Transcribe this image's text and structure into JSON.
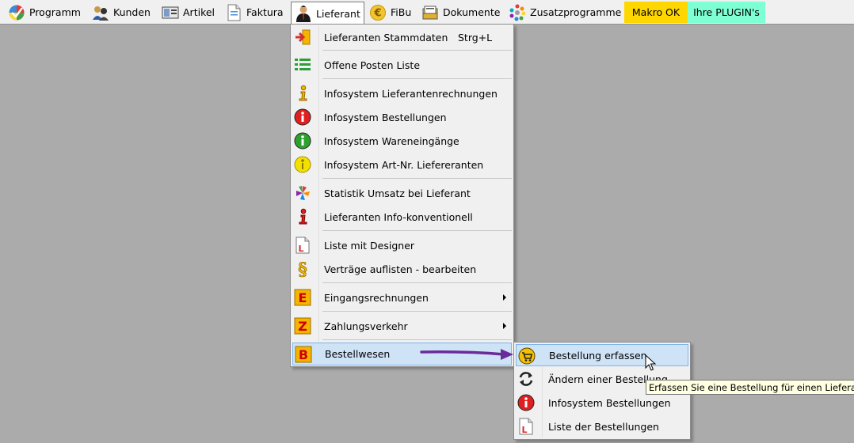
{
  "menubar": {
    "items": [
      {
        "label": "Programm",
        "icon": "programm-icon"
      },
      {
        "label": "Kunden",
        "icon": "kunden-icon"
      },
      {
        "label": "Artikel",
        "icon": "artikel-icon"
      },
      {
        "label": "Faktura",
        "icon": "faktura-icon"
      },
      {
        "label": "Lieferant",
        "icon": "lieferant-icon"
      },
      {
        "label": "FiBu",
        "icon": "fibu-icon"
      },
      {
        "label": "Dokumente",
        "icon": "dokumente-icon"
      },
      {
        "label": "Zusatzprogramme",
        "icon": "zusatzprogramme-icon"
      },
      {
        "label": "Makro OK",
        "color": "#ffd700"
      },
      {
        "label": "Ihre PLUGIN's",
        "color": "#7fffd4"
      }
    ]
  },
  "lieferant_menu": {
    "items": [
      {
        "label": "Lieferanten Stammdaten",
        "shortcut": "Strg+L",
        "icon": "stammdaten-login-icon"
      },
      {
        "label": "Offene Posten Liste",
        "icon": "list-icon"
      },
      {
        "label": "Infosystem Lieferantenrechnungen",
        "icon": "info-yellow-icon"
      },
      {
        "label": "Infosystem Bestellungen",
        "icon": "info-red-circle-icon"
      },
      {
        "label": "Infosystem Wareneingänge",
        "icon": "info-green-circle-icon"
      },
      {
        "label": "Infosystem Art-Nr. Liefereranten",
        "icon": "info-yellow-circle-icon"
      },
      {
        "label": "Statistik Umsatz bei Lieferant",
        "icon": "statistik-icon"
      },
      {
        "label": "Lieferanten Info-konventionell",
        "icon": "info-red-icon"
      },
      {
        "label": "Liste mit Designer",
        "icon": "liste-designer-icon"
      },
      {
        "label": "Verträge auflisten - bearbeiten",
        "icon": "vertraege-icon"
      },
      {
        "label": "Eingangsrechnungen",
        "icon": "letter-e-icon",
        "letter": "E"
      },
      {
        "label": "Zahlungsverkehr",
        "icon": "letter-z-icon",
        "letter": "Z"
      },
      {
        "label": "Bestellwesen",
        "icon": "letter-b-icon",
        "letter": "B"
      }
    ]
  },
  "bestellwesen_submenu": {
    "items": [
      {
        "label": "Bestellung erfassen",
        "icon": "bestellung-erfassen-icon"
      },
      {
        "label": "Ändern einer Bestellung",
        "icon": "refresh-icon"
      },
      {
        "label": "Infosystem Bestellungen",
        "icon": "info-red-circle-icon"
      },
      {
        "label": "Liste der Bestellungen",
        "icon": "liste-designer-icon"
      }
    ]
  },
  "tooltip": {
    "text": "Erfassen Sie eine Bestellung für einen Lieferanten"
  },
  "colors": {
    "arrow": "#6a2a9a",
    "highlight": "#cfe3f7",
    "desktop": "#ababab"
  }
}
